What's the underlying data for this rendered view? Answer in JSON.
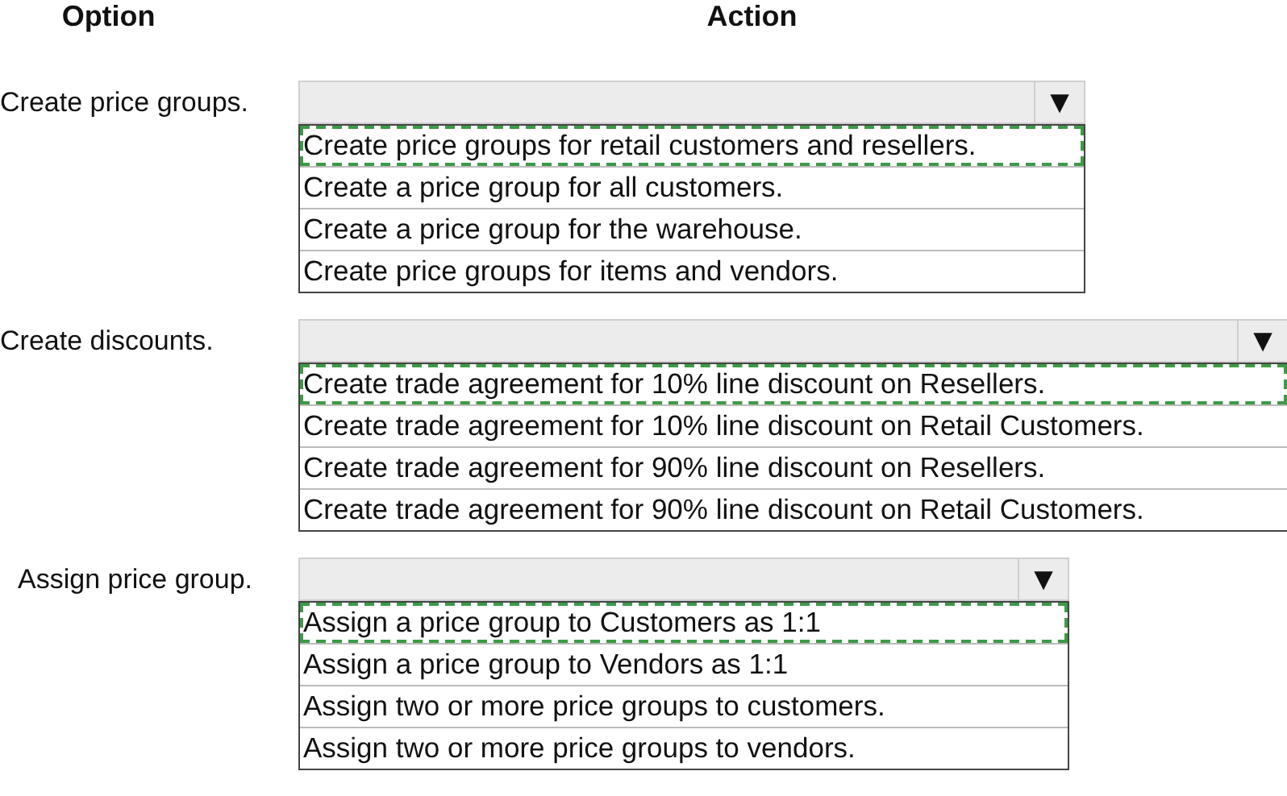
{
  "headers": [
    {
      "label": "Option"
    },
    {
      "label": "Action"
    }
  ],
  "rows": [
    {
      "option": "Create price groups.",
      "dropdown": {
        "arrow": "▼"
      },
      "choices": [
        {
          "text": "Create price groups for retail customers and resellers.",
          "selected": true
        },
        {
          "text": "Create a price group for all customers.",
          "selected": false
        },
        {
          "text": "Create a price group for the warehouse.",
          "selected": false
        },
        {
          "text": "Create price groups for items and vendors.",
          "selected": false
        }
      ]
    },
    {
      "option": "Create discounts.",
      "dropdown": {
        "arrow": "▼"
      },
      "choices": [
        {
          "text": "Create trade agreement for 10% line discount on Resellers.",
          "selected": true
        },
        {
          "text": "Create trade agreement for 10% line discount on Retail Customers.",
          "selected": false
        },
        {
          "text": "Create trade agreement for 90% line discount on Resellers.",
          "selected": false
        },
        {
          "text": "Create trade agreement for 90% line discount on Retail Customers.",
          "selected": false
        }
      ]
    },
    {
      "option": "Assign price group.",
      "dropdown": {
        "arrow": "▼"
      },
      "choices": [
        {
          "text": "Assign a price group to Customers as 1:1",
          "selected": true
        },
        {
          "text": "Assign a price group to Vendors as 1:1",
          "selected": false
        },
        {
          "text": "Assign two or more price groups to customers.",
          "selected": false
        },
        {
          "text": "Assign two or more price groups to vendors.",
          "selected": false
        }
      ]
    }
  ]
}
